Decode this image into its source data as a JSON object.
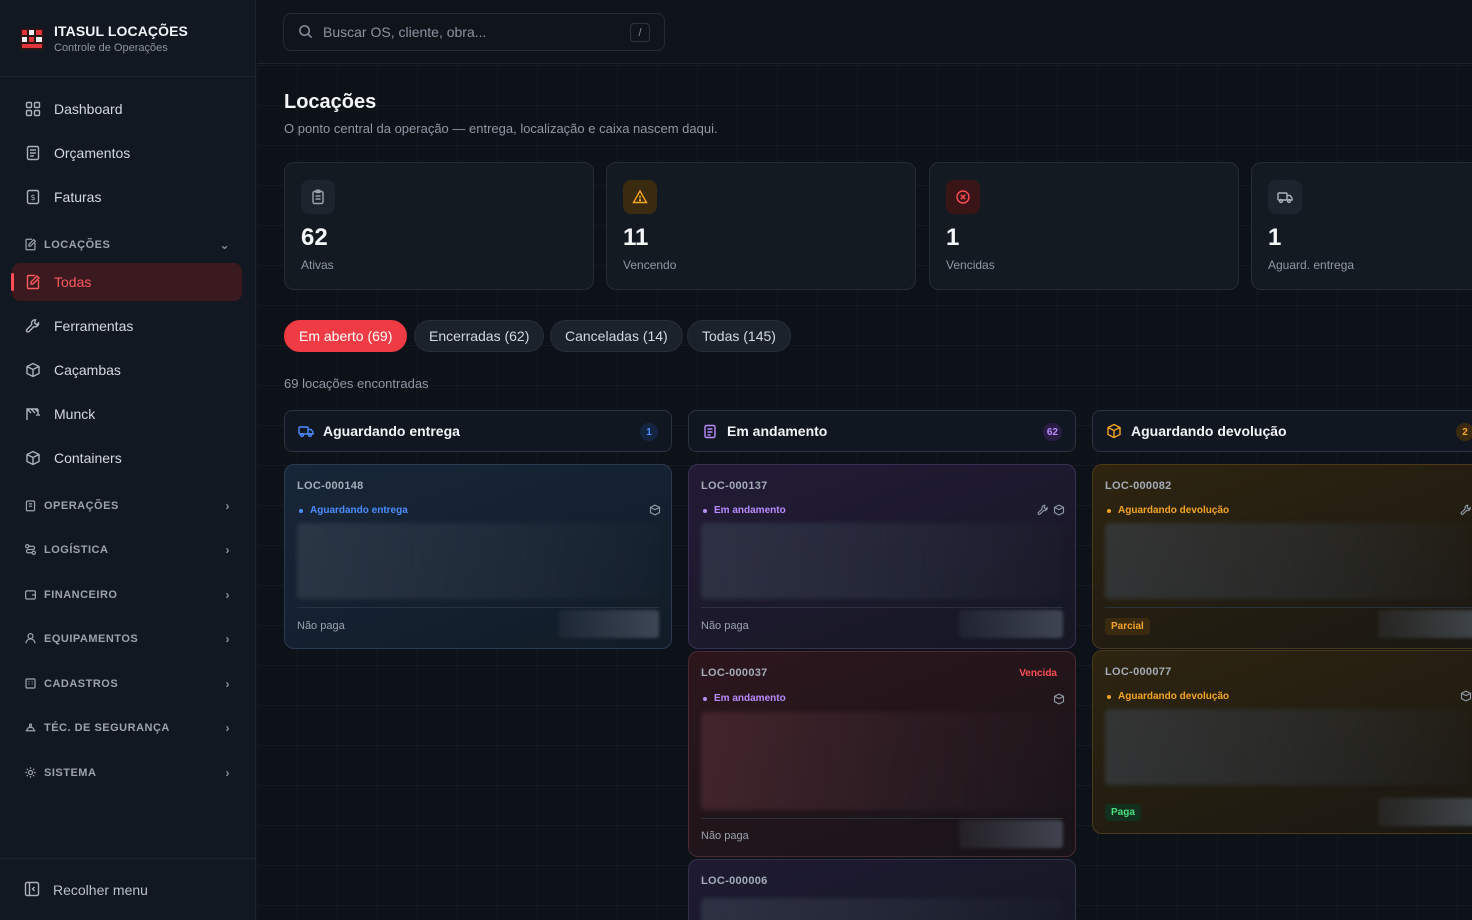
{
  "brand": {
    "title": "ITASUL LOCAÇÕES",
    "subtitle": "Controle de Operações"
  },
  "search": {
    "placeholder": "Buscar OS, cliente, obra...",
    "shortcut": "/"
  },
  "sidebar": {
    "items": [
      {
        "label": "Dashboard",
        "icon": "dashboard-icon"
      },
      {
        "label": "Orçamentos",
        "icon": "document-icon"
      },
      {
        "label": "Faturas",
        "icon": "invoice-icon"
      }
    ],
    "locacoes_section": "LOCAÇÕES",
    "locacoes_items": [
      {
        "label": "Todas",
        "icon": "edit-document-icon",
        "active": true
      },
      {
        "label": "Ferramentas",
        "icon": "wrench-icon"
      },
      {
        "label": "Caçambas",
        "icon": "box-icon"
      },
      {
        "label": "Munck",
        "icon": "crane-icon"
      },
      {
        "label": "Containers",
        "icon": "container-icon"
      }
    ],
    "sections": [
      {
        "label": "OPERAÇÕES",
        "icon": "clipboard-icon"
      },
      {
        "label": "LOGÍSTICA",
        "icon": "route-icon"
      },
      {
        "label": "FINANCEIRO",
        "icon": "wallet-icon"
      },
      {
        "label": "EQUIPAMENTOS",
        "icon": "user-gear-icon"
      },
      {
        "label": "CADASTROS",
        "icon": "building-icon"
      },
      {
        "label": "TÉC. DE SEGURANÇA",
        "icon": "hardhat-icon"
      },
      {
        "label": "SISTEMA",
        "icon": "gear-icon"
      }
    ],
    "collapse_label": "Recolher menu"
  },
  "page": {
    "title": "Locações",
    "subtitle": "O ponto central da operação — entrega, localização e caixa nascem daqui."
  },
  "stats": [
    {
      "value": "62",
      "label": "Ativas",
      "icon": "clipboard-icon",
      "color": "#9aa3af"
    },
    {
      "value": "11",
      "label": "Vencendo",
      "icon": "warning-icon",
      "color": "#f5a524"
    },
    {
      "value": "1",
      "label": "Vencidas",
      "icon": "x-circle-icon",
      "color": "#ff4d55"
    },
    {
      "value": "1",
      "label": "Aguard. entrega",
      "icon": "truck-icon",
      "color": "#9aa3af"
    }
  ],
  "tabs": [
    {
      "label": "Em aberto (69)",
      "active": true
    },
    {
      "label": "Encerradas (62)"
    },
    {
      "label": "Canceladas (14)"
    },
    {
      "label": "Todas (145)"
    }
  ],
  "result_count": "69 locações encontradas",
  "columns": [
    {
      "title": "Aguardando entrega",
      "count": "1",
      "icon": "truck-icon",
      "accent": "#4c8dff"
    },
    {
      "title": "Em andamento",
      "count": "62",
      "icon": "clipboard-icon",
      "accent": "#a06bff"
    },
    {
      "title": "Aguardando devolução",
      "count": "2",
      "icon": "box-icon",
      "accent": "#f5a524"
    }
  ],
  "cards": [
    {
      "id": "LOC-000148",
      "status": "Aguardando entrega",
      "payment": "Não paga"
    },
    {
      "id": "LOC-000137",
      "status": "Em andamento",
      "payment": "Não paga"
    },
    {
      "id": "LOC-000037",
      "status": "Em andamento",
      "tag": "Vencida",
      "payment": "Não paga"
    },
    {
      "id": "LOC-000006"
    },
    {
      "id": "LOC-000082",
      "status": "Aguardando devolução",
      "payment": "Parcial"
    },
    {
      "id": "LOC-000077",
      "status": "Aguardando devolução",
      "payment": "Paga"
    }
  ]
}
